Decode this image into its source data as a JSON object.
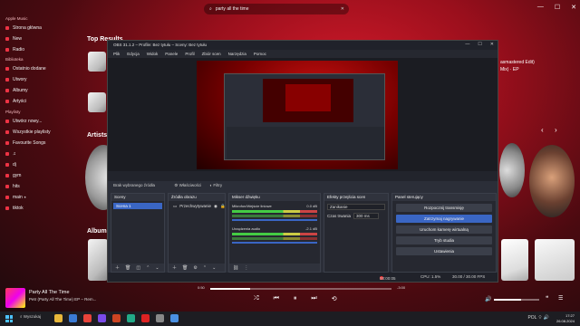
{
  "colors": {
    "accent": "#e0283a",
    "obs_accent": "#3a66c4"
  },
  "titlebar": {
    "search_text": "party all the time",
    "minimize": "—",
    "maximize": "☐",
    "close": "✕"
  },
  "sidebar": {
    "section_apple_music": "Apple Music",
    "item_home": "Strona główna",
    "item_new": "New",
    "item_radio": "Radio",
    "section_library": "Biblioteka",
    "item_recent": "Ostatnio dodane",
    "item_songs": "Utwory",
    "item_albums": "Albumy",
    "item_artists": "Artyści",
    "section_playlists": "Playlisty",
    "playlists": [
      "Utwórz nowy...",
      "Wszystkie playlisty",
      "Favourite Songs",
      "♫",
      "dj",
      "gym",
      "hits",
      "main ⭑",
      "tiktok"
    ]
  },
  "main": {
    "top_results_title": "Top Results",
    "artists_title": "Artists",
    "albums_title": "Albums",
    "right_text_1": "asmastered Edit)",
    "right_text_2": "Mix) · EP"
  },
  "player": {
    "title": "Party All The Time",
    "subtitle": "Petr (Party All The Time) EP – Rem...",
    "time_elapsed": "0:50",
    "time_remaining": "-3:00",
    "progress_fraction": 0.22,
    "volume_fraction": 0.6,
    "shuffle": "⤮",
    "prev": "⏮",
    "play": "⏸",
    "next": "⏭",
    "repeat": "⟲"
  },
  "taskbar": {
    "search": "Wyszukaj",
    "icon_colors": [
      "#e8b73a",
      "#3a7bd5",
      "#e8433a",
      "#7a4ae8",
      "#c42",
      "#2a8",
      "#d22",
      "#888",
      "#4a90e2"
    ],
    "time": "17:27",
    "date": "26.08.2024",
    "lang": "POL"
  },
  "obs": {
    "title": "OBS 31.1.2 – Profile: Bez tytułu – Sceny: Bez tytułu",
    "menu": [
      "Plik",
      "Edycja",
      "Widok",
      "Panele",
      "Profil",
      "Zbiór scen",
      "Narzędzia",
      "Pomoc"
    ],
    "toolbar_text": "Brak wybranego źródła",
    "toolbar_properties": "Właściwości",
    "toolbar_filters": "Filtry",
    "panels": {
      "scenes": {
        "title": "Sceny",
        "items": [
          "Scena 1"
        ]
      },
      "sources": {
        "title": "Źródła obrazu",
        "items": [
          "Przechwytywanie"
        ]
      },
      "mixer": {
        "title": "Mikser dźwięku",
        "tracks": [
          "Mikrofon/Wejście liniowe",
          "Urządzenia audio"
        ],
        "db_1": "0.0 dB",
        "db_2": "-2.1 dB"
      },
      "transitions": {
        "title": "Efekty przejścia scen",
        "type": "Zanikanie",
        "duration_label": "Czas trwania",
        "duration_value": "300 ms"
      },
      "controls": {
        "title": "Panel sterujący",
        "buttons": [
          "Rozpocznij transmisję",
          "Zatrzymaj nagrywanie",
          "Uruchom kamerę wirtualną",
          "Tryb studia",
          "Ustawienia"
        ]
      }
    },
    "status": {
      "rec": "00:00:05",
      "cpu": "CPU: 1.5%",
      "fps": "30.00 / 30.00 FPS"
    }
  }
}
